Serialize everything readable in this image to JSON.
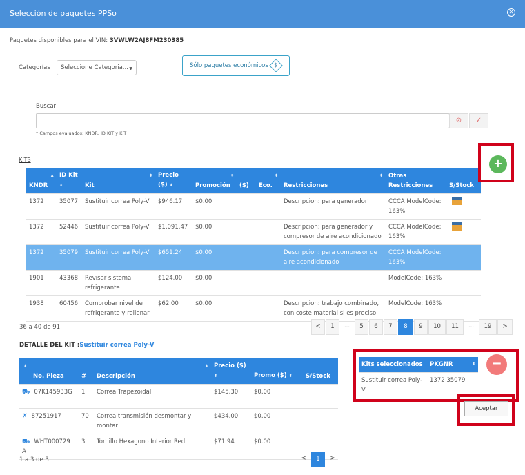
{
  "header": {
    "title": "Selección de paquetes PPSo"
  },
  "vin": {
    "label": "Paquetes disponibles para el VIN:",
    "value": "3VWLW2AJ8FM230385"
  },
  "categorias": {
    "label": "Categorías",
    "select_value": "Seleccione Categoria..."
  },
  "eco_button": {
    "label": "Sólo paquetes económicos",
    "icon": "dollar-diamond-icon"
  },
  "search": {
    "label": "Buscar",
    "value": "",
    "note": "* Campos evaluados: KNDR, ID KIT y KIT"
  },
  "kits": {
    "section_label": "KITS",
    "columns": [
      "KNDR",
      "ID Kit",
      "Kit",
      "Precio ($)",
      "Promoción",
      "($)",
      "Eco.",
      "Restricciones",
      "Otras Restricciones",
      "S/Stock"
    ],
    "rows": [
      {
        "kndr": "1372",
        "id": "35077",
        "kit": "Sustituir correa Poly-V",
        "precio": "$946.17",
        "promo": "$0.00",
        "restr": "Descripcion: para generador",
        "otras": "CCCA ModelCode: 163%",
        "stock": true,
        "selected": false
      },
      {
        "kndr": "1372",
        "id": "52446",
        "kit": "Sustituir correa Poly-V",
        "precio": "$1,091.47",
        "promo": "$0.00",
        "restr": "Descripcion: para generador y compresor de aire acondicionado",
        "otras": "CCCA ModelCode: 163%",
        "stock": true,
        "selected": false
      },
      {
        "kndr": "1372",
        "id": "35079",
        "kit": "Sustituir correa Poly-V",
        "precio": "$651.24",
        "promo": "$0.00",
        "restr": "Descripcion: para compresor de aire acondicionado",
        "otras": "CCCA ModelCode: 163%",
        "stock": false,
        "selected": true
      },
      {
        "kndr": "1901",
        "id": "43368",
        "kit": "Revisar sistema refrigerante",
        "precio": "$124.00",
        "promo": "$0.00",
        "restr": "",
        "otras": "ModelCode: 163%",
        "stock": false,
        "selected": false
      },
      {
        "kndr": "1938",
        "id": "60456",
        "kit": "Comprobar nivel de refrigerante y rellenar",
        "precio": "$62.00",
        "promo": "$0.00",
        "restr": "Descripcion: trabajo combinado, con coste material si es preciso",
        "otras": "ModelCode: 163%",
        "stock": false,
        "selected": false
      }
    ],
    "pager_info": "36 a 40 de 91",
    "pages": [
      "<",
      "1",
      "...",
      "5",
      "6",
      "7",
      "8",
      "9",
      "10",
      "11",
      "...",
      "19",
      ">"
    ],
    "active_page": "8"
  },
  "detail": {
    "title": "DETALLE DEL KIT :",
    "kit_name": "Sustituir correa Poly-V",
    "columns": [
      "No. Pieza",
      "#",
      "Descripción",
      "Precio ($)",
      "Promo ($)",
      "S/Stock"
    ],
    "rows": [
      {
        "icon": "car-icon",
        "pieza": "07K145933G",
        "num": "1",
        "desc": "Correa Trapezoidal",
        "precio": "$145.30",
        "promo": "$0.00"
      },
      {
        "icon": "tools-icon",
        "pieza": "87251917",
        "num": "70",
        "desc": "Correa transmisión desmontar y montar",
        "precio": "$434.00",
        "promo": "$0.00"
      },
      {
        "icon": "car-icon",
        "pieza": "WHT000729 A",
        "num": "3",
        "desc": "Tornillo Hexagono Interior Red",
        "precio": "$71.94",
        "promo": "$0.00"
      }
    ],
    "pager_info": "1 a 3 de 3",
    "pages": [
      "<",
      "1",
      ">"
    ]
  },
  "selected": {
    "columns": [
      "Kits seleccionados",
      "PKGNR"
    ],
    "rows": [
      {
        "kit": "Sustituir correa Poly-V",
        "pkgnr": "1372 35079"
      }
    ]
  },
  "aceptar_label": "Aceptar",
  "colors": {
    "header": "#4a90d9",
    "table_head": "#2e86de",
    "selected_row": "#6fb3ee",
    "highlight": "#d0021b",
    "add": "#5cb85c",
    "remove": "#f27a7a"
  }
}
